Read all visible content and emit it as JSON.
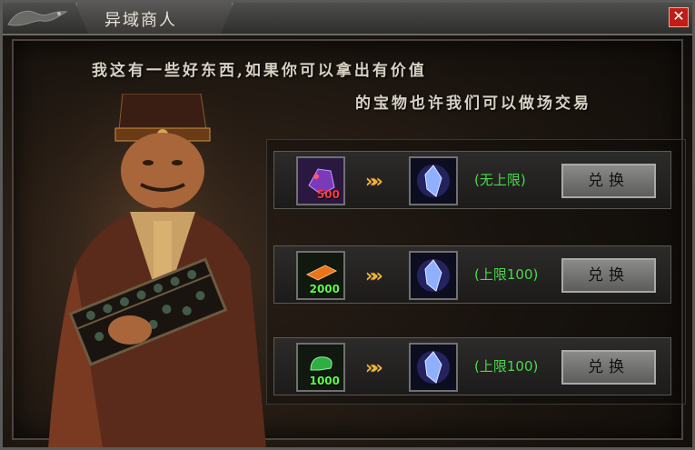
{
  "window": {
    "title": "异域商人",
    "close_label": "✕"
  },
  "dialog": {
    "line1": "我这有一些好东西,如果你可以拿出有价值",
    "line2": "的宝物也许我们可以做场交易"
  },
  "trades": [
    {
      "cost_icon": "purple-gem-pouch-icon",
      "cost_count": "500",
      "cost_count_color": "#ff3a3a",
      "reward_icon": "blue-crystal-icon",
      "arrows": "»»",
      "limit": "(无上限)",
      "button": "兑换"
    },
    {
      "cost_icon": "orange-token-icon",
      "cost_count": "2000",
      "cost_count_color": "#5cff4a",
      "reward_icon": "blue-crystal-icon",
      "arrows": "»»",
      "limit": "(上限100)",
      "button": "兑换"
    },
    {
      "cost_icon": "green-scroll-icon",
      "cost_count": "1000",
      "cost_count_color": "#5cff4a",
      "reward_icon": "blue-crystal-icon",
      "arrows": "»»",
      "limit": "(上限100)",
      "button": "兑换"
    }
  ],
  "colors": {
    "limit_text": "#49d94a",
    "arrow": "#f2b33a",
    "close_button": "#c21c14"
  }
}
